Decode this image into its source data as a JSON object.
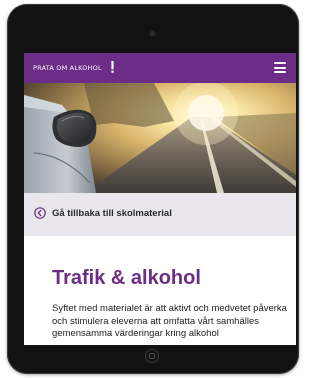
{
  "header": {
    "brand": "PRATA OM ALKOHOL",
    "brand_mark": "!",
    "menu_icon": "hamburger-menu-icon"
  },
  "hero_image": {
    "subject": "car side mirror on road at sunset"
  },
  "back_link": {
    "icon": "arrow-left-circle-icon",
    "label": "Gå tillbaka till skolmaterial"
  },
  "article": {
    "title": "Trafik & alkohol",
    "intro": "Syftet med materialet är att aktivt och medvetet påverka och stimulera eleverna att omfatta vårt samhälles gemensamma värderingar kring alkohol"
  },
  "colors": {
    "brand_purple": "#6b2d86",
    "back_bar_bg": "#e9e7ec",
    "device_frame": "#121212"
  }
}
